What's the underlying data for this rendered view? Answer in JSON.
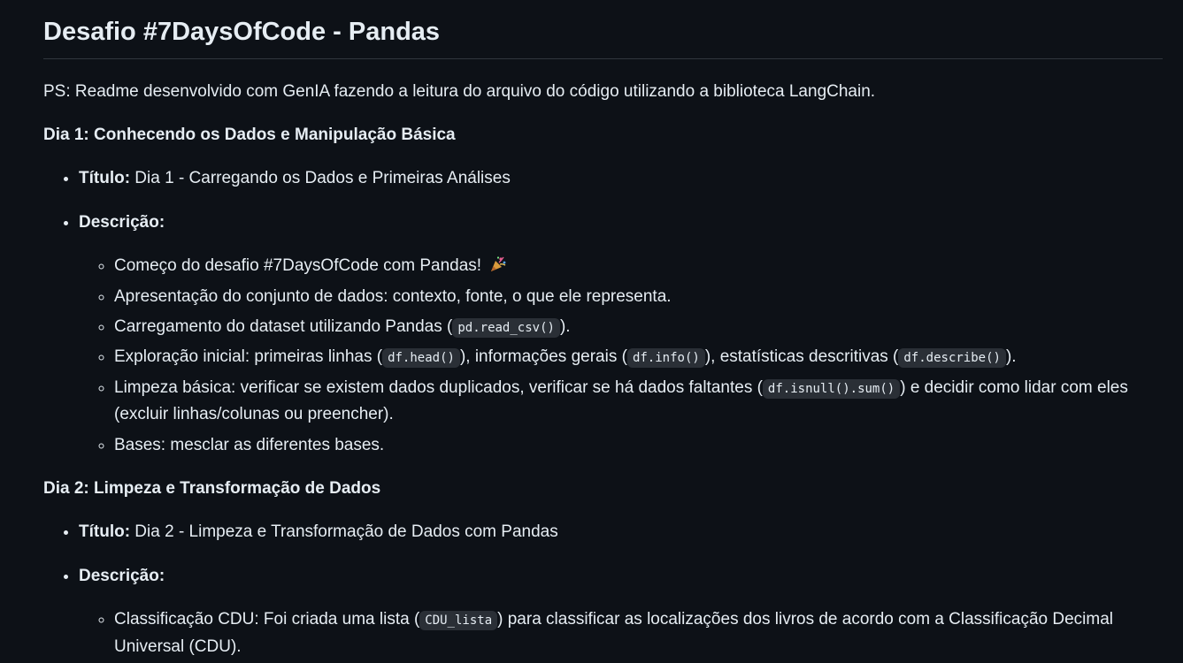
{
  "title": "Desafio #7DaysOfCode - Pandas",
  "ps": "PS: Readme desenvolvido com GenIA fazendo a leitura do arquivo do código utilizando a biblioteca LangChain.",
  "labels": {
    "titulo": "Título:",
    "descricao": "Descrição:"
  },
  "day1": {
    "heading": "Dia 1: Conhecendo os Dados e Manipulação Básica",
    "titulo_value": " Dia 1 - Carregando os Dados e Primeiras Análises",
    "items": {
      "i0": "Começo do desafio #7DaysOfCode com Pandas! ",
      "i1": "Apresentação do conjunto de dados: contexto, fonte, o que ele representa.",
      "i2_a": "Carregamento do dataset utilizando Pandas (",
      "i2_code": "pd.read_csv()",
      "i2_b": ").",
      "i3_a": "Exploração inicial: primeiras linhas (",
      "i3_code1": "df.head()",
      "i3_b": "), informações gerais (",
      "i3_code2": "df.info()",
      "i3_c": "), estatísticas descritivas (",
      "i3_code3": "df.describe()",
      "i3_d": ").",
      "i4_a": "Limpeza básica: verificar se existem dados duplicados, verificar se há dados faltantes (",
      "i4_code": "df.isnull().sum()",
      "i4_b": ") e decidir como lidar com eles (excluir linhas/colunas ou preencher).",
      "i5": "Bases: mesclar as diferentes bases."
    }
  },
  "day2": {
    "heading": "Dia 2: Limpeza e Transformação de Dados",
    "titulo_value": " Dia 2 - Limpeza e Transformação de Dados com Pandas",
    "items": {
      "i0_a": "Classificação CDU: Foi criada uma lista (",
      "i0_code": "CDU_lista",
      "i0_b": ") para classificar as localizações dos livros de acordo com a Classificação Decimal Universal (CDU)."
    }
  },
  "icons": {
    "party": "party-popper-icon"
  },
  "colors": {
    "background": "#0d1117",
    "text": "#e6edf3",
    "code_bg": "#2a2f36",
    "divider": "#30363d"
  }
}
